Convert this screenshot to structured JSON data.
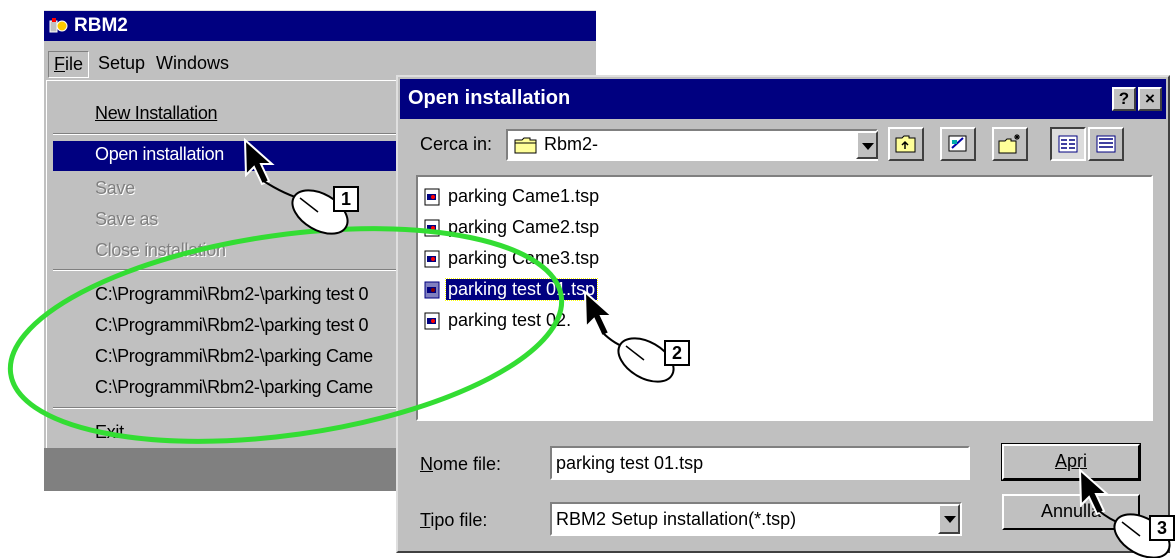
{
  "app": {
    "title": "RBM2",
    "menu": {
      "file": "File",
      "setup": "Setup",
      "windows": "Windows"
    },
    "file_menu": {
      "new_installation": "New Installation",
      "open_installation": "Open installation",
      "save": "Save",
      "save_as": "Save as",
      "close_installation": "Close installation",
      "recent": [
        "C:\\Programmi\\Rbm2-\\parking test 0",
        "C:\\Programmi\\Rbm2-\\parking test 0",
        "C:\\Programmi\\Rbm2-\\parking Came",
        "C:\\Programmi\\Rbm2-\\parking Came"
      ],
      "exit": "Exit"
    }
  },
  "dialog": {
    "title": "Open installation",
    "help_label": "?",
    "close_label": "×",
    "look_in_label": "Cerca in:",
    "look_in_value": "Rbm2-",
    "files": [
      "parking Came1.tsp",
      "parking Came2.tsp",
      "parking Came3.tsp",
      "parking test 01.tsp",
      "parking test 02."
    ],
    "selected_index": 3,
    "filename_label": "Nome file:",
    "filename_value": "parking test 01.tsp",
    "filetype_label": "Tipo file:",
    "filetype_value": "RBM2 Setup installation(*.tsp)",
    "open_button": "Apri",
    "cancel_button": "Annulla"
  },
  "annotations": {
    "step1": "1",
    "step2": "2",
    "step3": "3"
  },
  "colors": {
    "title_bar": "#000080",
    "highlight": "#000080",
    "face": "#c0c0c0",
    "ellipse": "#33dd33"
  }
}
